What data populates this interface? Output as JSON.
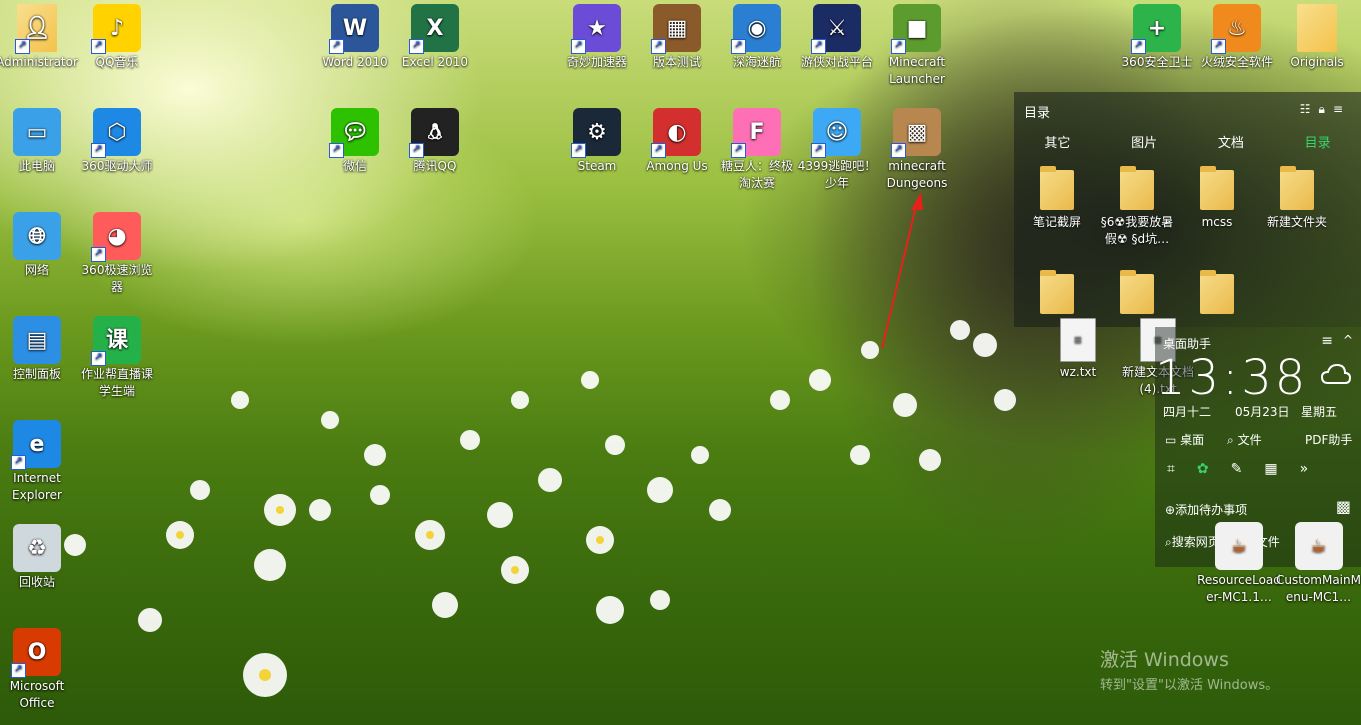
{
  "desktop_icons": [
    {
      "name": "Administrator",
      "icon": "user-folder-icon",
      "color": "#f4c24a"
    },
    {
      "name": "QQ音乐",
      "icon": "qq-music-icon",
      "color": "#ffd200"
    },
    {
      "name": "Word 2010",
      "icon": "word-icon",
      "color": "#2b579a"
    },
    {
      "name": "Excel 2010",
      "icon": "excel-icon",
      "color": "#217346"
    },
    {
      "name": "奇妙加速器",
      "icon": "accelerator-icon",
      "color": "#6b4cd6"
    },
    {
      "name": "版本测试",
      "icon": "crafting-table-icon",
      "color": "#8b5a2b"
    },
    {
      "name": "深海迷航",
      "icon": "subnautica-icon",
      "color": "#2a7fd3"
    },
    {
      "name": "游侠对战平台",
      "icon": "youxia-icon",
      "color": "#1b2b63"
    },
    {
      "name": "Minecraft Launcher",
      "icon": "minecraft-grass-icon",
      "color": "#5c9b2e"
    },
    {
      "name": "360安全卫士",
      "icon": "360-security-icon",
      "color": "#2cb34a"
    },
    {
      "name": "火绒安全软件",
      "icon": "huorong-icon",
      "color": "#f08a1c"
    },
    {
      "name": "Originals",
      "icon": "folder-icon",
      "color": "#f4c24a"
    },
    {
      "name": "此电脑",
      "icon": "computer-icon",
      "color": "#3aa0e8"
    },
    {
      "name": "360驱动大师",
      "icon": "driver-master-icon",
      "color": "#1e88e5"
    },
    {
      "name": "微信",
      "icon": "wechat-icon",
      "color": "#2dc100"
    },
    {
      "name": "腾讯QQ",
      "icon": "qq-penguin-icon",
      "color": "#222222"
    },
    {
      "name": "Steam",
      "icon": "steam-icon",
      "color": "#1b2838"
    },
    {
      "name": "Among Us",
      "icon": "among-us-icon",
      "color": "#d32f2f"
    },
    {
      "name": "糖豆人：终极淘汰赛",
      "icon": "fall-guys-icon",
      "color": "#ff6fb5"
    },
    {
      "name": "4399逃跑吧！少年",
      "icon": "escape-game-icon",
      "color": "#3da9f5"
    },
    {
      "name": "minecraft Dungeons",
      "icon": "dungeons-icon",
      "color": "#b8874f"
    },
    {
      "name": "网络",
      "icon": "network-icon",
      "color": "#3aa0e8"
    },
    {
      "name": "360极速浏览器",
      "icon": "browser-icon",
      "color": "#ff5b5b"
    },
    {
      "name": "控制面板",
      "icon": "control-panel-icon",
      "color": "#2d8fe3"
    },
    {
      "name": "作业帮直播课学生端",
      "icon": "zuoyebang-icon",
      "color": "#25b14a"
    },
    {
      "name": "Internet Explorer",
      "icon": "ie-icon",
      "color": "#1e88e5"
    },
    {
      "name": "回收站",
      "icon": "recycle-bin-icon",
      "color": "#cfd8dc"
    },
    {
      "name": "Microsoft Office",
      "icon": "office-icon",
      "color": "#d83b01"
    }
  ],
  "fence": {
    "title": "目录",
    "tabs": [
      "其它",
      "图片",
      "文档",
      "目录"
    ],
    "active_tab": "目录",
    "items": [
      "笔记截屏",
      "§6☢我要放暑假☢ §d坑…",
      "mcss",
      "新建文件夹"
    ],
    "row2_items": [
      "",
      "",
      ""
    ]
  },
  "overlay_files": [
    "wz.txt",
    "新建文本文档 (4).txt"
  ],
  "assistant": {
    "title": "桌面助手",
    "time": "13:38",
    "weekday_lunar": "四月十二",
    "date": "05月23日",
    "weekday": "星期五",
    "actions": [
      "桌面",
      "文件",
      "PDF助手"
    ],
    "todo": "添加待办事项",
    "search_placeholder": "搜索网页、查找文件"
  },
  "java_files": [
    "ResourceLoader-MC1.1…",
    "CustomMainMenu-MC1…"
  ],
  "watermark": {
    "line1": "激活 Windows",
    "line2": "转到\"设置\"以激活 Windows。"
  }
}
